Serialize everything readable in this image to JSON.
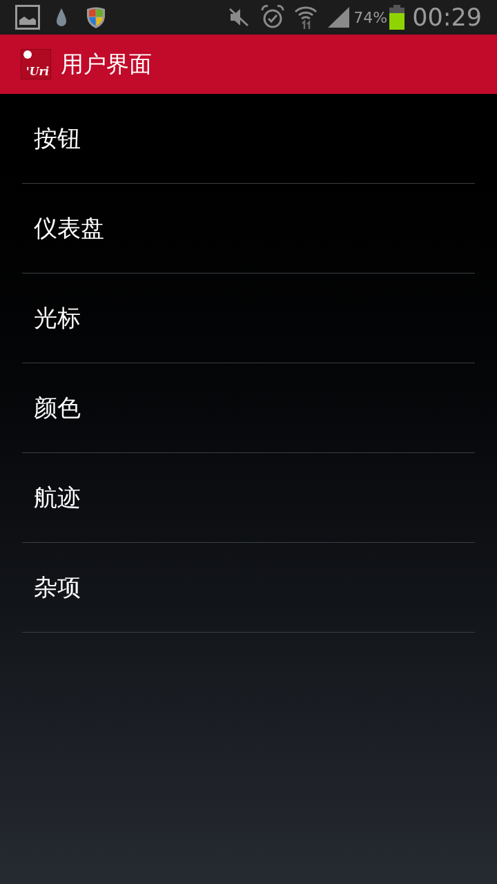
{
  "status_bar": {
    "battery_text": "74%",
    "time": "00:29"
  },
  "action_bar": {
    "logo_text": "'Uri",
    "title": "用户界面"
  },
  "items": [
    {
      "label": "按钮"
    },
    {
      "label": "仪表盘"
    },
    {
      "label": "光标"
    },
    {
      "label": "颜色"
    },
    {
      "label": "航迹"
    },
    {
      "label": "杂项"
    }
  ]
}
